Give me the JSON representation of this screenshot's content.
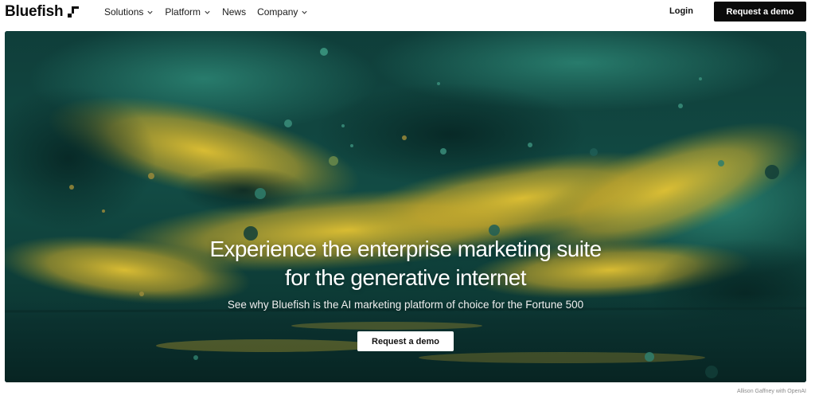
{
  "nav": {
    "logo_text": "Bluefish",
    "logo_icon": "bluefish-logo-mark",
    "menu": [
      {
        "label": "Solutions",
        "has_dropdown": true
      },
      {
        "label": "Platform",
        "has_dropdown": true
      },
      {
        "label": "News",
        "has_dropdown": false
      },
      {
        "label": "Company",
        "has_dropdown": true
      }
    ],
    "login_label": "Login",
    "cta_label": "Request a demo"
  },
  "hero": {
    "title_line1": "Experience the enterprise marketing suite",
    "title_line2": "for the generative internet",
    "subtitle": "See why Bluefish is the AI marketing platform of choice for the Fortune 500",
    "cta_label": "Request a demo",
    "image_credit": "Allison Gaffney with OpenAI"
  },
  "colors": {
    "accent": "#0a0a0a",
    "hero_teal": "#0c3a38",
    "hero_yellow": "#d7b52a"
  }
}
